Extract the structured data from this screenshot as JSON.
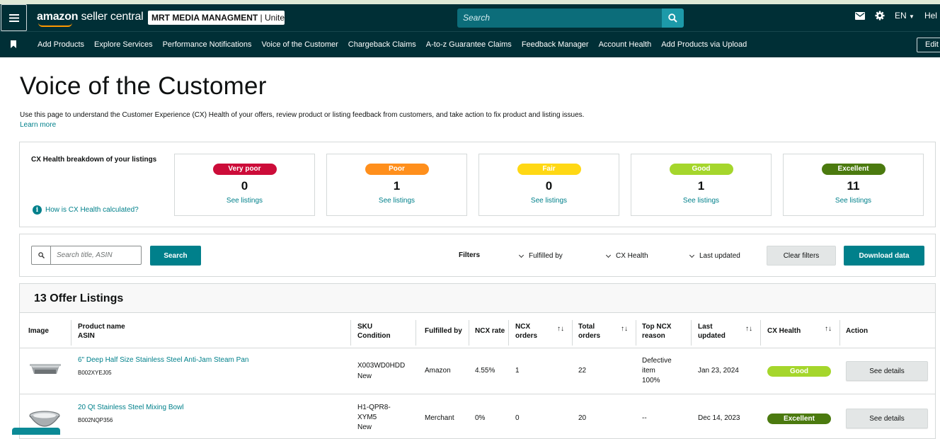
{
  "header": {
    "logo_amazon": "amazon",
    "logo_rest": " seller central",
    "account_name": "MRT MEDIA MANAGMENT",
    "account_region": " | Unite...",
    "search_placeholder": "Search",
    "language": "EN",
    "help_label": "Hel"
  },
  "nav": {
    "items": [
      "Add Products",
      "Explore Services",
      "Performance Notifications",
      "Voice of the Customer",
      "Chargeback Claims",
      "A-to-z Guarantee Claims",
      "Feedback Manager",
      "Account Health",
      "Add Products via Upload"
    ],
    "edit_label": "Edit"
  },
  "page": {
    "title": "Voice of the Customer",
    "intro": "Use this page to understand the Customer Experience (CX) Health of your offers, review product or listing feedback from customers, and take action to fix product and listing issues.",
    "learn_more": "Learn more"
  },
  "breakdown": {
    "title": "CX Health breakdown of your listings",
    "help_link": "How is CX Health calculated?",
    "help_icon_text": "i",
    "cards": [
      {
        "label": "Very poor",
        "count": "0",
        "link": "See listings",
        "color": "#cc0c39",
        "text_color": "#ffffff"
      },
      {
        "label": "Poor",
        "count": "1",
        "link": "See listings",
        "color": "#ff8f1c",
        "text_color": "#ffffff"
      },
      {
        "label": "Fair",
        "count": "0",
        "link": "See listings",
        "color": "#ffd814",
        "text_color": "#ffffff"
      },
      {
        "label": "Good",
        "count": "1",
        "link": "See listings",
        "color": "#a5d62c",
        "text_color": "#ffffff"
      },
      {
        "label": "Excellent",
        "count": "11",
        "link": "See listings",
        "color": "#4b7a0f",
        "text_color": "#ffffff"
      }
    ]
  },
  "filters": {
    "search_placeholder": "Search title, ASIN",
    "search_button": "Search",
    "filters_label": "Filters",
    "fulfilled_by": "Fulfilled by",
    "cx_health": "CX Health",
    "last_updated": "Last updated",
    "clear_filters": "Clear filters",
    "download_data": "Download data"
  },
  "listings": {
    "heading": "13 Offer Listings",
    "columns": {
      "image": "Image",
      "product_name": "Product name",
      "asin": "ASIN",
      "sku": "SKU",
      "condition": "Condition",
      "fulfilled_by": "Fulfilled by",
      "ncx_rate": "NCX rate",
      "ncx_orders_1": "NCX",
      "ncx_orders_2": "orders",
      "total_orders_1": "Total",
      "total_orders_2": "orders",
      "top_ncx_1": "Top NCX",
      "top_ncx_2": "reason",
      "last_updated_1": "Last",
      "last_updated_2": "updated",
      "cx_health": "CX Health",
      "action": "Action",
      "sort_glyph": "↑↓"
    },
    "rows": [
      {
        "name": "6\" Deep Half Size Stainless Steel Anti-Jam Steam Pan",
        "asin": "B002XYEJ05",
        "sku": "X003WD0HDD",
        "condition": "New",
        "fulfilled_by": "Amazon",
        "ncx_rate": "4.55%",
        "ncx_orders": "1",
        "total_orders": "22",
        "top_ncx_1": "Defective",
        "top_ncx_2": "item",
        "top_ncx_3": "100%",
        "last_updated": "Jan 23, 2024",
        "health": "Good",
        "health_color": "#a5d62c",
        "action": "See details"
      },
      {
        "name": "20 Qt Stainless Steel Mixing Bowl",
        "asin": "B002NQP356",
        "sku_1": "H1-QPR8-",
        "sku_2": "XYM5",
        "condition": "New",
        "fulfilled_by": "Merchant",
        "ncx_rate": "0%",
        "ncx_orders": "0",
        "total_orders": "20",
        "top_ncx_1": "--",
        "last_updated": "Dec 14, 2023",
        "health": "Excellent",
        "health_color": "#4b7a0f",
        "action": "See details"
      }
    ]
  }
}
